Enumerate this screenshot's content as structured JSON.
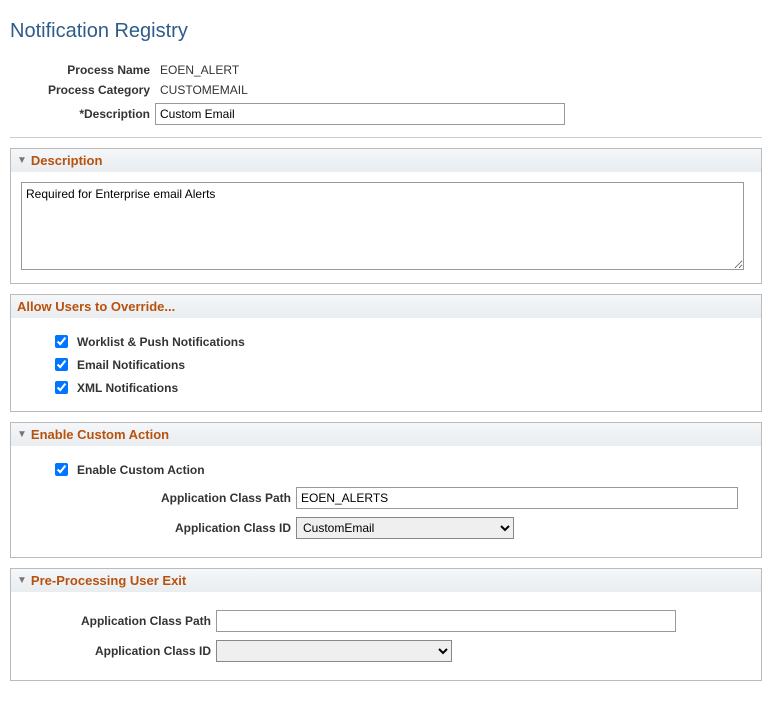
{
  "page": {
    "title": "Notification Registry"
  },
  "header": {
    "process_name_label": "Process Name",
    "process_name_value": "EOEN_ALERT",
    "process_category_label": "Process Category",
    "process_category_value": "CUSTOMEMAIL",
    "description_label": "*Description",
    "description_value": "Custom Email"
  },
  "description_section": {
    "title": "Description",
    "text": "Required for Enterprise email Alerts"
  },
  "override_section": {
    "title": "Allow Users to Override...",
    "worklist_label": "Worklist & Push Notifications",
    "worklist_checked": true,
    "email_label": "Email Notifications",
    "email_checked": true,
    "xml_label": "XML Notifications",
    "xml_checked": true
  },
  "custom_action_section": {
    "title": "Enable Custom Action",
    "enable_label": "Enable Custom Action",
    "enable_checked": true,
    "app_class_path_label": "Application Class Path",
    "app_class_path_value": "EOEN_ALERTS",
    "app_class_id_label": "Application Class ID",
    "app_class_id_value": "CustomEmail"
  },
  "preproc_section": {
    "title": "Pre-Processing User Exit",
    "app_class_path_label": "Application Class Path",
    "app_class_path_value": "",
    "app_class_id_label": "Application Class ID",
    "app_class_id_value": ""
  }
}
